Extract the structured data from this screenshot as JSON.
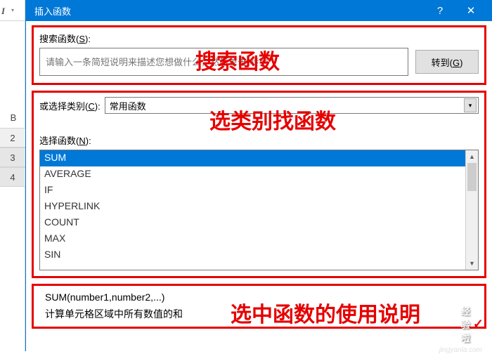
{
  "excel": {
    "toolbar_italic": "I",
    "col_b": "B",
    "rows": [
      "2",
      "3",
      "4"
    ]
  },
  "dialog": {
    "title": "插入函数",
    "help_icon": "?",
    "close_icon": "✕"
  },
  "search": {
    "label_prefix": "搜索函数(",
    "label_key": "S",
    "label_suffix": "):",
    "placeholder": "请输入一条简短说明来描述您想做什么，然后单击\"转到\"",
    "go_prefix": "转到(",
    "go_key": "G",
    "go_suffix": ")",
    "overlay": "搜索函数"
  },
  "category": {
    "label_prefix": "或选择类别(",
    "label_key": "C",
    "label_suffix": "):",
    "selected": "常用函数",
    "overlay": "选类别找函数"
  },
  "funclist": {
    "label_prefix": "选择函数(",
    "label_key": "N",
    "label_suffix": "):",
    "items": [
      "SUM",
      "AVERAGE",
      "IF",
      "HYPERLINK",
      "COUNT",
      "MAX",
      "SIN"
    ],
    "selected_index": 0
  },
  "description": {
    "signature": "SUM(number1,number2,...)",
    "text": "计算单元格区域中所有数值的和",
    "overlay": "选中函数的使用说明"
  },
  "watermark": {
    "brand": "经验啦",
    "check": "✓",
    "url": "jingyanla.com"
  }
}
